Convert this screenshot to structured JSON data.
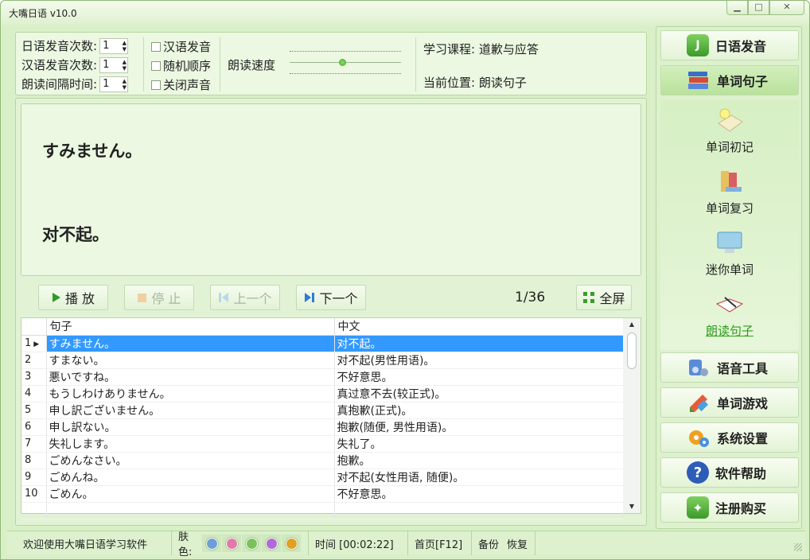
{
  "window": {
    "title": "大嘴日语 v10.0",
    "min_label": "▁",
    "max_label": "□",
    "close_label": "✕"
  },
  "settings": {
    "jp_count_label": "日语发音次数:",
    "jp_count": "1",
    "cn_count_label": "汉语发音次数:",
    "cn_count": "1",
    "interval_label": "朗读间隔时间:",
    "interval": "1",
    "chk_cn": "汉语发音",
    "chk_random": "随机顺序",
    "chk_mute": "关闭声音",
    "speed_label": "朗读速度",
    "course": "学习课程: 道歉与应答",
    "position": "当前位置: 朗读句子"
  },
  "display": {
    "japanese": "すみません。",
    "chinese": "对不起。"
  },
  "controls": {
    "play": "播 放",
    "stop": "停 止",
    "prev": "上一个",
    "next": "下一个",
    "counter": "1/36",
    "fullscreen": "全屏"
  },
  "table": {
    "headers": [
      "句子",
      "中文"
    ],
    "rows": [
      {
        "n": "1",
        "jp": "すみません。",
        "cn": "对不起。",
        "selected": true
      },
      {
        "n": "2",
        "jp": "すまない。",
        "cn": "对不起(男性用语)。"
      },
      {
        "n": "3",
        "jp": "悪いですね。",
        "cn": "不好意思。"
      },
      {
        "n": "4",
        "jp": "もうしわけありません。",
        "cn": "真过意不去(较正式)。"
      },
      {
        "n": "5",
        "jp": "申し訳ございません。",
        "cn": "真抱歉(正式)。"
      },
      {
        "n": "6",
        "jp": "申し訳ない。",
        "cn": "抱歉(随便, 男性用语)。"
      },
      {
        "n": "7",
        "jp": "失礼します。",
        "cn": "失礼了。"
      },
      {
        "n": "8",
        "jp": "ごめんなさい。",
        "cn": "抱歉。"
      },
      {
        "n": "9",
        "jp": "ごめんね。",
        "cn": "对不起(女性用语, 随便)。"
      },
      {
        "n": "10",
        "jp": "ごめん。",
        "cn": "不好意思。"
      }
    ]
  },
  "nav": {
    "jp_pron": "日语发音",
    "words_sentences": "单词句子",
    "sub": [
      "单词初记",
      "单词复习",
      "迷你单词",
      "朗读句子"
    ],
    "voice_tools": "语音工具",
    "word_games": "单词游戏",
    "settings": "系统设置",
    "help": "软件帮助",
    "register": "注册购买"
  },
  "status": {
    "welcome": "欢迎使用大嘴日语学习软件",
    "skin_label": "肤色:",
    "skins": [
      "#6d9fd6",
      "#e27aa8",
      "#79c25a",
      "#b06ad8",
      "#e0a020"
    ],
    "time": "时间 [00:02:22]",
    "home": "首页[F12]",
    "backup": "备份",
    "restore": "恢复"
  },
  "colors": {
    "accent": "#3399ff",
    "panel": "#ecf8e2",
    "frame": "#b6d6a0"
  }
}
